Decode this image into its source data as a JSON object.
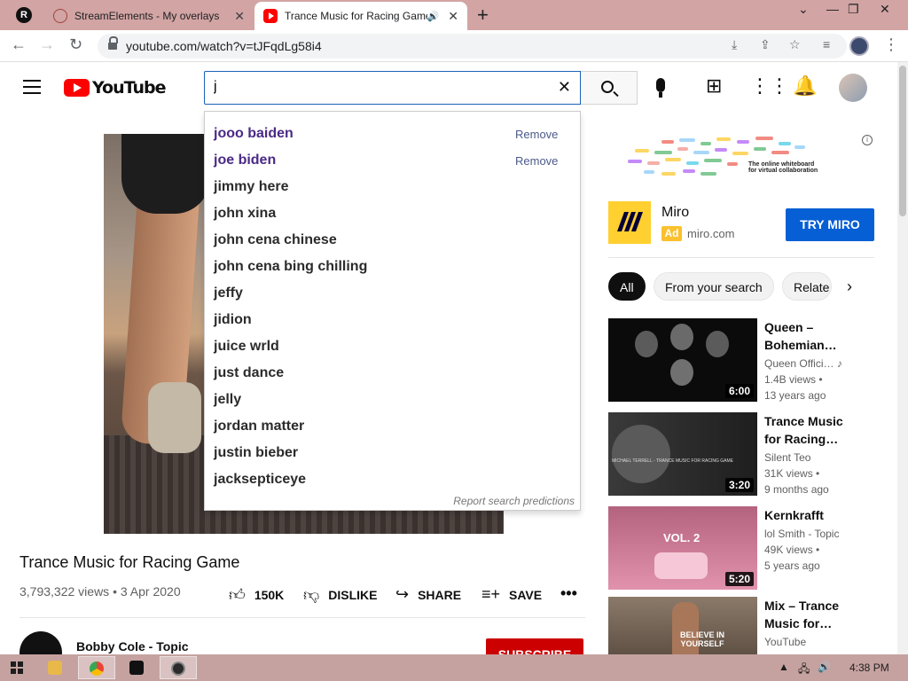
{
  "browser": {
    "tabs": [
      {
        "title": "StreamElements - My overlays",
        "active": false
      },
      {
        "title": "Trance Music for Racing Game",
        "active": true
      }
    ],
    "url": "youtube.com/watch?v=tJFqdLg58i4"
  },
  "youtube": {
    "logo_text": "YouTube",
    "search_value": "j",
    "suggestions": [
      {
        "text": "jooo baiden",
        "recent": true,
        "action": "Remove"
      },
      {
        "text": "joe biden",
        "recent": true,
        "action": "Remove"
      },
      {
        "text": "jimmy here"
      },
      {
        "text": "john xina"
      },
      {
        "text": "john cena chinese"
      },
      {
        "text": "john cena bing chilling"
      },
      {
        "text": "jeffy"
      },
      {
        "text": "jidion"
      },
      {
        "text": "juice wrld"
      },
      {
        "text": "just dance"
      },
      {
        "text": "jelly"
      },
      {
        "text": "jordan matter"
      },
      {
        "text": "justin bieber"
      },
      {
        "text": "jacksepticeye"
      }
    ],
    "report_label": "Report search predictions"
  },
  "video": {
    "title": "Trance Music for Racing Game",
    "views": "3,793,322 views",
    "date": "3 Apr 2020",
    "like_count": "150K",
    "dislike_label": "DISLIKE",
    "share_label": "SHARE",
    "save_label": "SAVE",
    "channel": "Bobby Cole - Topic",
    "subscribe_label": "SUBSCRIBE"
  },
  "ad": {
    "banner_text_1": "The online whiteboard",
    "banner_text_2": "for virtual collaboration",
    "name": "Miro",
    "badge": "Ad",
    "domain": "miro.com",
    "cta": "TRY MIRO"
  },
  "chips": [
    "All",
    "From your search",
    "Relate"
  ],
  "recommendations": [
    {
      "title": "Queen – Bohemian…",
      "channel": "Queen Offici…",
      "views": "1.4B views •",
      "age": "13 years ago",
      "duration": "6:00"
    },
    {
      "title": "Trance Music for Racing…",
      "channel": "Silent Teo",
      "views": "31K views •",
      "age": "9 months ago",
      "duration": "3:20",
      "thumb_text": "MICHAEL TERRELL - TRANCE MUSIC FOR RACING GAME"
    },
    {
      "title": "Kernkrafft",
      "channel": "lol Smith - Topic",
      "views": "49K views •",
      "age": "5 years ago",
      "duration": "5:20",
      "thumb_text": "VOL. 2"
    },
    {
      "title": "Mix – Trance Music for…",
      "channel": "YouTube",
      "views": "",
      "age": "",
      "duration": "",
      "thumb_text": "BELIEVE IN YOURSELF"
    }
  ],
  "taskbar": {
    "time": "4:38 PM"
  },
  "colors": {
    "yt_red": "#ff0000",
    "cta_blue": "#065fd4",
    "subscribe_red": "#cc0000",
    "titlebar_pink": "#d2a4a3"
  }
}
